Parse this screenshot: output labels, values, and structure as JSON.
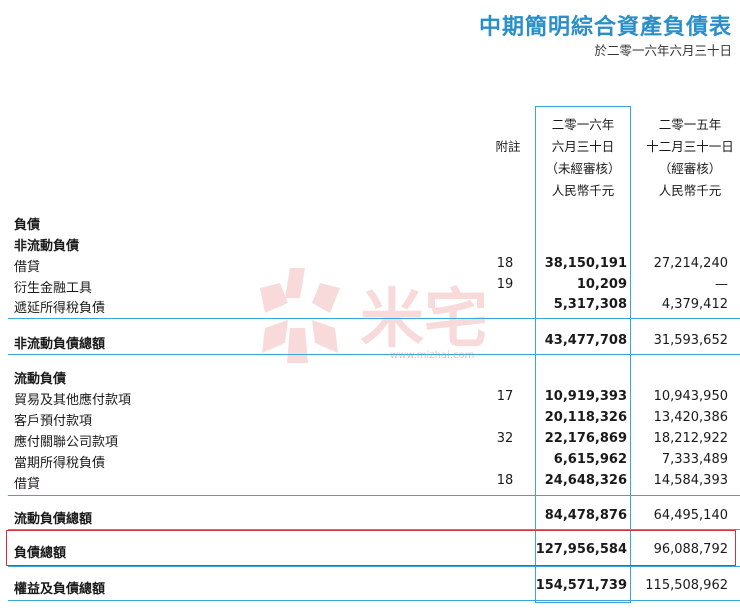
{
  "title": "中期簡明綜合資產負債表",
  "subtitle": "於二零一六年六月三十日",
  "header": {
    "note": "附註",
    "current": [
      "二零一六年",
      "六月三十日",
      "（未經審核）",
      "人民幣千元"
    ],
    "previous": [
      "二零一五年",
      "十二月三十一日",
      "（經審核）",
      "人民幣千元"
    ]
  },
  "sections": {
    "liabilities": "負債",
    "non_current": "非流動負債",
    "current": "流動負債"
  },
  "rows": [
    {
      "label": "借貸",
      "note": "18",
      "cur": "38,150,191",
      "prev": "27,214,240"
    },
    {
      "label": "衍生金融工具",
      "note": "19",
      "cur": "10,209",
      "prev": "—"
    },
    {
      "label": "遞延所得稅負債",
      "note": "",
      "cur": "5,317,308",
      "prev": "4,379,412"
    },
    {
      "label": "非流動負債總額",
      "note": "",
      "cur": "43,477,708",
      "prev": "31,593,652"
    },
    {
      "label": "貿易及其他應付款項",
      "note": "17",
      "cur": "10,919,393",
      "prev": "10,943,950"
    },
    {
      "label": "客戶預付款項",
      "note": "",
      "cur": "20,118,326",
      "prev": "13,420,386"
    },
    {
      "label": "應付關聯公司款項",
      "note": "32",
      "cur": "22,176,869",
      "prev": "18,212,922"
    },
    {
      "label": "當期所得稅負債",
      "note": "",
      "cur": "6,615,962",
      "prev": "7,333,489"
    },
    {
      "label": "借貸",
      "note": "18",
      "cur": "24,648,326",
      "prev": "14,584,393"
    },
    {
      "label": "流動負債總額",
      "note": "",
      "cur": "84,478,876",
      "prev": "64,495,140"
    },
    {
      "label": "負債總額",
      "note": "",
      "cur": "127,956,584",
      "prev": "96,088,792"
    },
    {
      "label": "權益及負債總額",
      "note": "",
      "cur": "154,571,739",
      "prev": "115,508,962"
    }
  ],
  "watermark": {
    "text": "米宅",
    "url": "www.mizhai.com"
  },
  "colors": {
    "accent": "#2a8fc8",
    "line": "#3aa7dc",
    "highlight": "#d0353b"
  }
}
